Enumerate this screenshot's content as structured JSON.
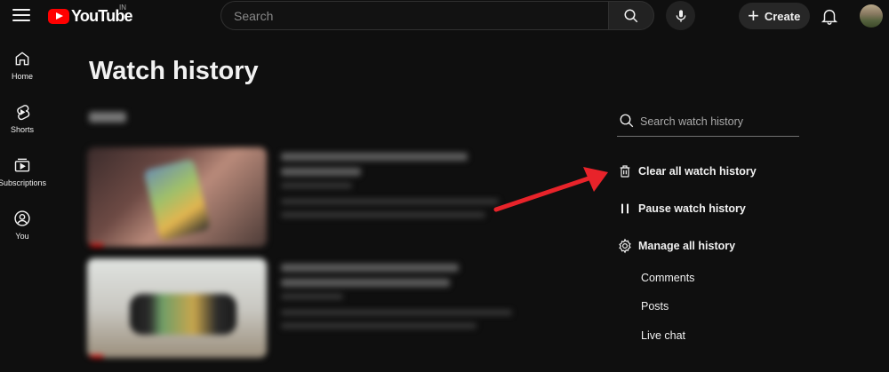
{
  "header": {
    "logo_text": "YouTube",
    "region_code": "IN",
    "search_placeholder": "Search",
    "create_label": "Create"
  },
  "sidebar": {
    "items": [
      {
        "label": "Home",
        "icon": "home-icon"
      },
      {
        "label": "Shorts",
        "icon": "shorts-icon"
      },
      {
        "label": "Subscriptions",
        "icon": "subscriptions-icon"
      },
      {
        "label": "You",
        "icon": "you-icon"
      }
    ]
  },
  "main": {
    "title": "Watch history"
  },
  "history_panel": {
    "search_placeholder": "Search watch history",
    "clear_label": "Clear all watch history",
    "pause_label": "Pause watch history",
    "manage_label": "Manage all history",
    "sub_links": [
      "Comments",
      "Posts",
      "Live chat"
    ]
  },
  "colors": {
    "background": "#0f0f0f",
    "brand_red": "#ff0000",
    "annotation_arrow": "#e8232a"
  }
}
